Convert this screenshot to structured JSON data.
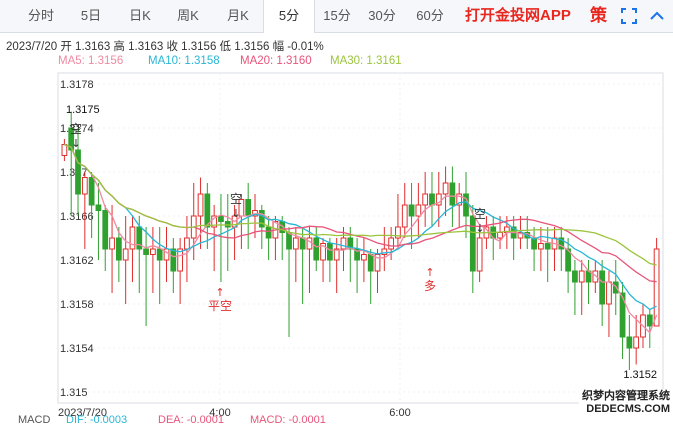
{
  "tabs": [
    {
      "label": "分时",
      "active": false
    },
    {
      "label": "5日",
      "active": false
    },
    {
      "label": "日K",
      "active": false
    },
    {
      "label": "周K",
      "active": false
    },
    {
      "label": "月K",
      "active": false
    },
    {
      "label": "5分",
      "active": true
    },
    {
      "label": "15分",
      "active": false
    },
    {
      "label": "30分",
      "active": false
    },
    {
      "label": "60分",
      "active": false
    }
  ],
  "promo": "打开金投网APP",
  "strategy_label": "策",
  "icons": {
    "fullscreen": "fullscreen-icon",
    "collapse": "chevron-up-icon"
  },
  "info": "2023/7/20  开 1.3163  高 1.3163  收 1.3156  低 1.3156  幅 -0.01%",
  "ma": [
    {
      "label": "MA5: 1.3156",
      "color": "#f08aa3"
    },
    {
      "label": "MA10: 1.3158",
      "color": "#29b6d6"
    },
    {
      "label": "MA20: 1.3160",
      "color": "#e8547a"
    },
    {
      "label": "MA30: 1.3161",
      "color": "#9bc53d"
    }
  ],
  "colors": {
    "up": "#e02e2e",
    "down": "#2fa12f"
  },
  "chart_data": {
    "type": "candlestick",
    "y_ticks": [
      "1.3178",
      "1.3174",
      "1.317",
      "1.3166",
      "1.3162",
      "1.3158",
      "1.3154",
      "1.315"
    ],
    "y_range": [
      1.3149,
      1.3179
    ],
    "x_ticks": [
      "2023/7/20",
      "4:00",
      "6:00",
      "2023/7/20"
    ],
    "high_label": "1.3175",
    "low_label": "1.3152",
    "annotations": [
      "空",
      "空",
      "平空",
      "多",
      "空"
    ],
    "candles": [
      [
        1.31715,
        1.31725,
        1.3173,
        1.3171
      ],
      [
        1.3174,
        1.3172,
        1.31755,
        1.3166
      ],
      [
        1.3172,
        1.3168,
        1.3174,
        1.3166
      ],
      [
        1.3168,
        1.31695,
        1.317,
        1.3163
      ],
      [
        1.31695,
        1.3167,
        1.317,
        1.3164
      ],
      [
        1.3167,
        1.31665,
        1.3169,
        1.3162
      ],
      [
        1.31665,
        1.3163,
        1.3167,
        1.3161
      ],
      [
        1.3163,
        1.3164,
        1.3167,
        1.3159
      ],
      [
        1.3164,
        1.3162,
        1.3165,
        1.316
      ],
      [
        1.3162,
        1.3163,
        1.3166,
        1.3158
      ],
      [
        1.3163,
        1.3165,
        1.3166,
        1.316
      ],
      [
        1.3165,
        1.3163,
        1.3166,
        1.3159
      ],
      [
        1.3163,
        1.31625,
        1.3165,
        1.3156
      ],
      [
        1.31625,
        1.3163,
        1.3165,
        1.3159
      ],
      [
        1.3163,
        1.3162,
        1.3165,
        1.3158
      ],
      [
        1.3162,
        1.3163,
        1.3165,
        1.316
      ],
      [
        1.3163,
        1.3161,
        1.3164,
        1.3159
      ],
      [
        1.3161,
        1.3163,
        1.3164,
        1.3158
      ],
      [
        1.3163,
        1.3164,
        1.3166,
        1.316
      ],
      [
        1.3164,
        1.3166,
        1.3169,
        1.3162
      ],
      [
        1.3166,
        1.3168,
        1.31695,
        1.3163
      ],
      [
        1.3168,
        1.3165,
        1.3169,
        1.3163
      ],
      [
        1.3165,
        1.3166,
        1.3167,
        1.3161
      ],
      [
        1.3166,
        1.31655,
        1.3168,
        1.316
      ],
      [
        1.31655,
        1.3165,
        1.3168,
        1.3161
      ],
      [
        1.3165,
        1.3166,
        1.3167,
        1.3162
      ],
      [
        1.3166,
        1.31675,
        1.3168,
        1.3163
      ],
      [
        1.31675,
        1.3166,
        1.3169,
        1.3163
      ],
      [
        1.3166,
        1.31665,
        1.3168,
        1.3164
      ],
      [
        1.31665,
        1.3165,
        1.3167,
        1.3163
      ],
      [
        1.3165,
        1.3164,
        1.3166,
        1.3162
      ],
      [
        1.3164,
        1.31655,
        1.3166,
        1.3162
      ],
      [
        1.31655,
        1.31645,
        1.3166,
        1.3162
      ],
      [
        1.31645,
        1.3163,
        1.3165,
        1.3155
      ],
      [
        1.3163,
        1.3164,
        1.3165,
        1.316
      ],
      [
        1.3164,
        1.3163,
        1.3165,
        1.3158
      ],
      [
        1.3163,
        1.3164,
        1.3165,
        1.3159
      ],
      [
        1.3164,
        1.3162,
        1.3165,
        1.3161
      ],
      [
        1.3162,
        1.31635,
        1.3164,
        1.316
      ],
      [
        1.31635,
        1.3162,
        1.3164,
        1.316
      ],
      [
        1.3162,
        1.3163,
        1.3164,
        1.3159
      ],
      [
        1.3163,
        1.3164,
        1.3165,
        1.3161
      ],
      [
        1.3164,
        1.3163,
        1.3165,
        1.316
      ],
      [
        1.3163,
        1.3162,
        1.3164,
        1.3159
      ],
      [
        1.3162,
        1.31625,
        1.3164,
        1.316
      ],
      [
        1.31625,
        1.3161,
        1.3163,
        1.3158
      ],
      [
        1.3161,
        1.31625,
        1.3163,
        1.3159
      ],
      [
        1.31625,
        1.3163,
        1.3165,
        1.3161
      ],
      [
        1.3163,
        1.3164,
        1.3165,
        1.3162
      ],
      [
        1.3164,
        1.3165,
        1.3168,
        1.3163
      ],
      [
        1.3165,
        1.3167,
        1.3169,
        1.3164
      ],
      [
        1.3167,
        1.3166,
        1.3169,
        1.3163
      ],
      [
        1.3166,
        1.3167,
        1.3169,
        1.3164
      ],
      [
        1.3167,
        1.3168,
        1.317,
        1.3165
      ],
      [
        1.3168,
        1.3167,
        1.317,
        1.3165
      ],
      [
        1.3167,
        1.3168,
        1.317,
        1.3165
      ],
      [
        1.3168,
        1.3169,
        1.31705,
        1.3166
      ],
      [
        1.3169,
        1.3167,
        1.31705,
        1.3165
      ],
      [
        1.3167,
        1.3168,
        1.3169,
        1.3165
      ],
      [
        1.3168,
        1.3166,
        1.317,
        1.3164
      ],
      [
        1.3166,
        1.3161,
        1.3167,
        1.3159
      ],
      [
        1.3161,
        1.3164,
        1.3165,
        1.316
      ],
      [
        1.3164,
        1.3165,
        1.3166,
        1.3163
      ],
      [
        1.3165,
        1.3164,
        1.3166,
        1.3162
      ],
      [
        1.3164,
        1.31645,
        1.3166,
        1.3163
      ],
      [
        1.31645,
        1.3165,
        1.3166,
        1.3163
      ],
      [
        1.3165,
        1.3164,
        1.3166,
        1.3162
      ],
      [
        1.3164,
        1.31645,
        1.3166,
        1.3163
      ],
      [
        1.31645,
        1.3164,
        1.3166,
        1.3163
      ],
      [
        1.3164,
        1.3163,
        1.3165,
        1.3161
      ],
      [
        1.3163,
        1.31635,
        1.3165,
        1.3161
      ],
      [
        1.31635,
        1.3163,
        1.3165,
        1.316
      ],
      [
        1.3163,
        1.3164,
        1.3165,
        1.3161
      ],
      [
        1.3164,
        1.3163,
        1.3165,
        1.3161
      ],
      [
        1.3163,
        1.3161,
        1.3164,
        1.3159
      ],
      [
        1.3161,
        1.316,
        1.3162,
        1.3157
      ],
      [
        1.316,
        1.3161,
        1.3162,
        1.3157
      ],
      [
        1.3161,
        1.316,
        1.3162,
        1.3158
      ],
      [
        1.316,
        1.3161,
        1.3162,
        1.3159
      ],
      [
        1.3161,
        1.3158,
        1.3162,
        1.3156
      ],
      [
        1.3158,
        1.316,
        1.3161,
        1.3155
      ],
      [
        1.316,
        1.3159,
        1.3162,
        1.3157
      ],
      [
        1.3159,
        1.3155,
        1.316,
        1.3153
      ],
      [
        1.3155,
        1.3154,
        1.3157,
        1.3152
      ],
      [
        1.3154,
        1.3155,
        1.3157,
        1.31525
      ],
      [
        1.3155,
        1.3157,
        1.3158,
        1.3154
      ],
      [
        1.3157,
        1.3156,
        1.31575,
        1.3154
      ],
      [
        1.3156,
        1.3163,
        1.3164,
        1.3156
      ]
    ]
  },
  "macd": [
    {
      "label": "MACD",
      "color": "#555555"
    },
    {
      "label": "DIF: -0.0003",
      "color": "#29b6d6"
    },
    {
      "label": "DEA: -0.0001",
      "color": "#e8547a"
    },
    {
      "label": "MACD: -0.0001",
      "color": "#e8547a"
    }
  ],
  "watermark": [
    "织梦内容管理系统",
    "DEDECMS.COM"
  ]
}
